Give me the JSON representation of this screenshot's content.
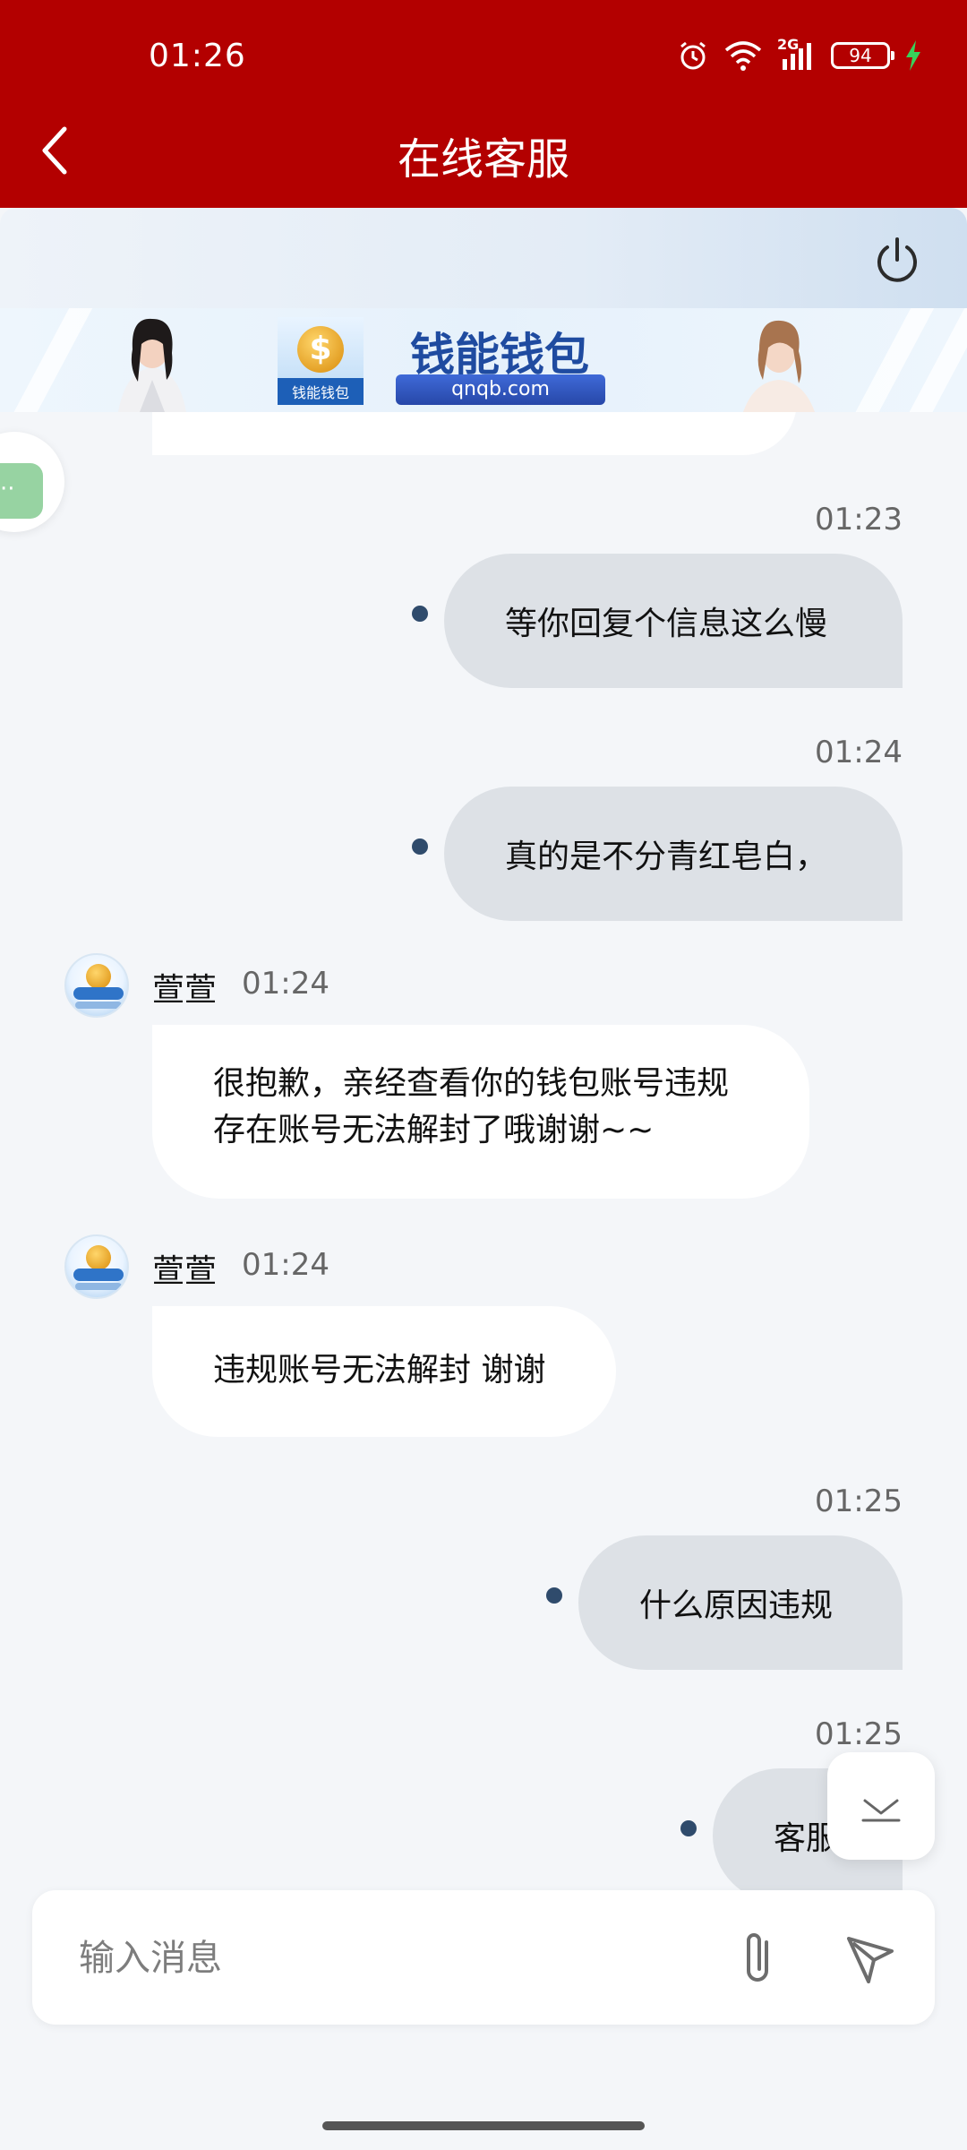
{
  "status_bar": {
    "time": "01:26",
    "network": "2G",
    "battery": "94",
    "icons": [
      "alarm-icon",
      "wifi-icon",
      "signal-icon",
      "battery-icon",
      "charging-icon"
    ]
  },
  "header": {
    "title": "在线客服",
    "background": "#b30000"
  },
  "banner": {
    "brand_name": "钱能钱包",
    "url": "qnqb.com",
    "logo_text": "钱能钱包"
  },
  "messages": [
    {
      "direction": "outgoing",
      "time": "01:23",
      "text": "等你回复个信息这么慢"
    },
    {
      "direction": "outgoing",
      "time": "01:24",
      "text": "真的是不分青红皂白，"
    },
    {
      "direction": "incoming",
      "sender": "萱萱",
      "time": "01:24",
      "lines": [
        "很抱歉，亲经查看你的钱包账号违规",
        "存在账号无法解封了哦谢谢~~"
      ]
    },
    {
      "direction": "incoming",
      "sender": "萱萱",
      "time": "01:24",
      "lines": [
        "违规账号无法解封 谢谢"
      ]
    },
    {
      "direction": "outgoing",
      "time": "01:25",
      "text": "什么原因违规"
    },
    {
      "direction": "outgoing",
      "time": "01:25",
      "text": "客服"
    }
  ],
  "input": {
    "placeholder": "输入消息",
    "value": ""
  },
  "colors": {
    "outgoing_bubble": "#dde1e6",
    "incoming_bubble": "#ffffff",
    "unread_dot": "#2f4b6c"
  }
}
